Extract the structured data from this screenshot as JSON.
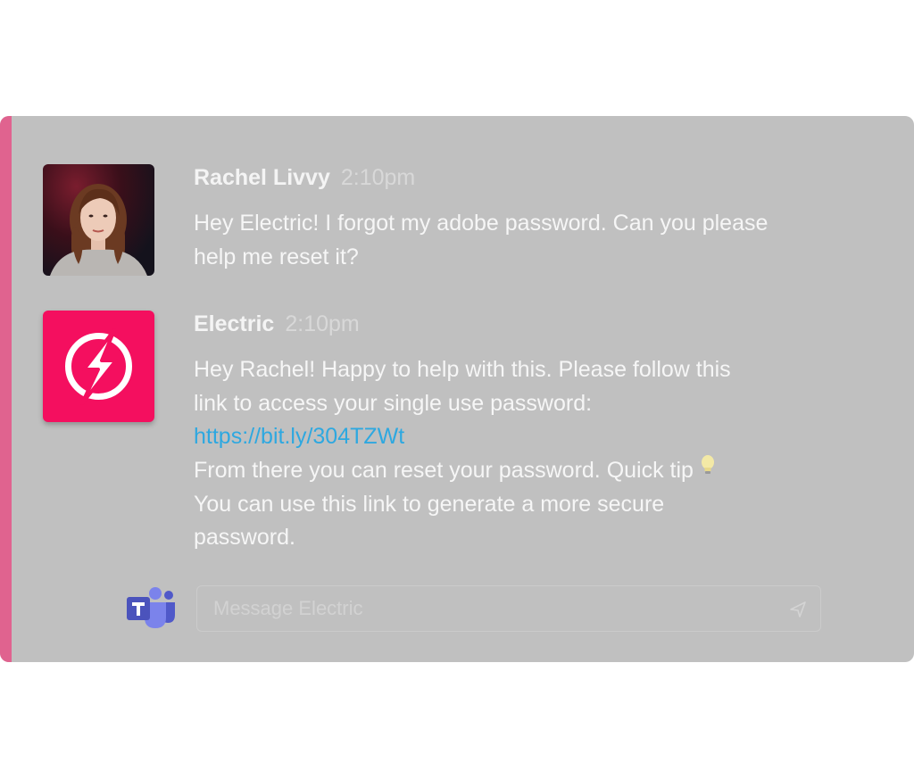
{
  "colors": {
    "panel_background": "#c0c0c0",
    "accent_bar": "#e0638f",
    "bot_avatar": "#f40f5f",
    "link": "#2ea8e0"
  },
  "messages": [
    {
      "sender": "Rachel Livvy",
      "time": "2:10pm",
      "avatar": "user-photo",
      "lines": [
        "Hey Electric! I forgot my adobe password. Can you please",
        "help me reset it?"
      ]
    },
    {
      "sender": "Electric",
      "time": "2:10pm",
      "avatar": "lightning-bolt-icon",
      "lines": [
        "Hey Rachel! Happy to help with this. Please follow this",
        "link to access your single use password:"
      ],
      "link": "https://bit.ly/304TZWt",
      "after_link_lines": [
        "From there you can reset your password. Quick tip",
        "You can use this link to generate a more secure",
        "password."
      ],
      "tip_icon": "lightbulb-icon"
    }
  ],
  "composer": {
    "logo_icon": "microsoft-teams-icon",
    "placeholder": "Message Electric",
    "send_icon": "send-icon"
  }
}
